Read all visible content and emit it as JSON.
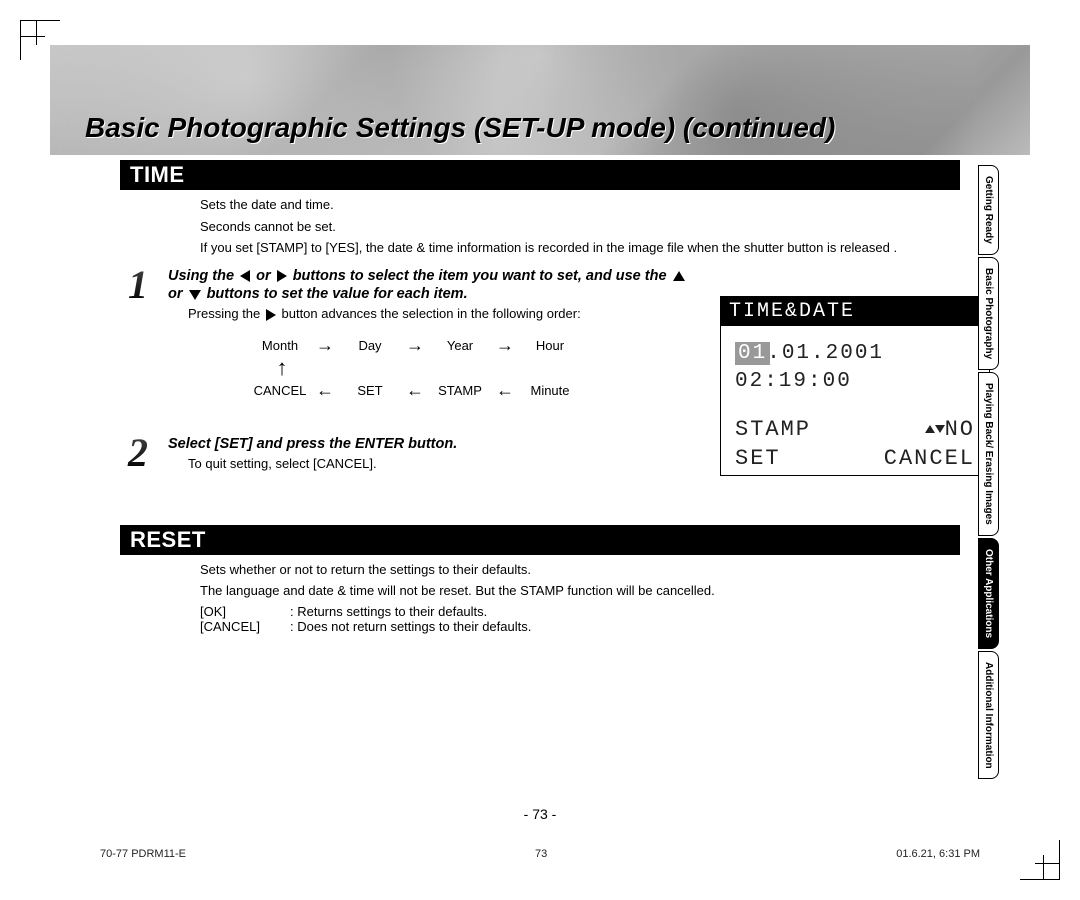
{
  "header": {
    "title": "Basic Photographic Settings (SET-UP mode) (continued)"
  },
  "time_section": {
    "heading": "TIME",
    "desc": [
      "Sets the date and time.",
      "Seconds cannot be set.",
      "If you set [STAMP] to [YES], the date & time information is recorded in the image file when the shutter button is released ."
    ],
    "step1": {
      "bold_a": "Using the ",
      "bold_b": " or ",
      "bold_c": " buttons to select the item you want to set, and use the ",
      "bold_d": " or ",
      "bold_e": " buttons to set the value for each item.",
      "sub_a": "Pressing the ",
      "sub_b": " button advances the selection in the following order:"
    },
    "flow": {
      "r1": [
        "Month",
        "Day",
        "Year",
        "Hour"
      ],
      "r2": [
        "CANCEL",
        "SET",
        "STAMP",
        "Minute"
      ]
    },
    "step2": {
      "bold": "Select [SET] and press the ENTER button.",
      "sub": "To quit setting, select [CANCEL]."
    }
  },
  "lcd": {
    "title": "TIME&DATE",
    "month": "01",
    "rest_date": ".01.2001",
    "time": "02:19:00",
    "stamp_label": "STAMP",
    "stamp_value": "NO",
    "set": "SET",
    "cancel": "CANCEL"
  },
  "reset_section": {
    "heading": "RESET",
    "desc": [
      "Sets whether or not to return the settings to their defaults.",
      "The language and date & time will not be reset. But the STAMP function will be cancelled."
    ],
    "defs": [
      {
        "term": "[OK]",
        "val": ": Returns settings to their defaults."
      },
      {
        "term": "[CANCEL]",
        "val": ": Does not return settings to their defaults."
      }
    ]
  },
  "sidebar": [
    {
      "label": "Getting Ready",
      "active": false
    },
    {
      "label": "Basic Photography",
      "active": false
    },
    {
      "label": "Playing Back/ Erasing Images",
      "active": false
    },
    {
      "label": "Other Applications",
      "active": true
    },
    {
      "label": "Additional Information",
      "active": false
    }
  ],
  "page_number": "- 73 -",
  "footer": {
    "left": "70-77 PDRM11-E",
    "center": "73",
    "right": "01.6.21, 6:31 PM"
  }
}
